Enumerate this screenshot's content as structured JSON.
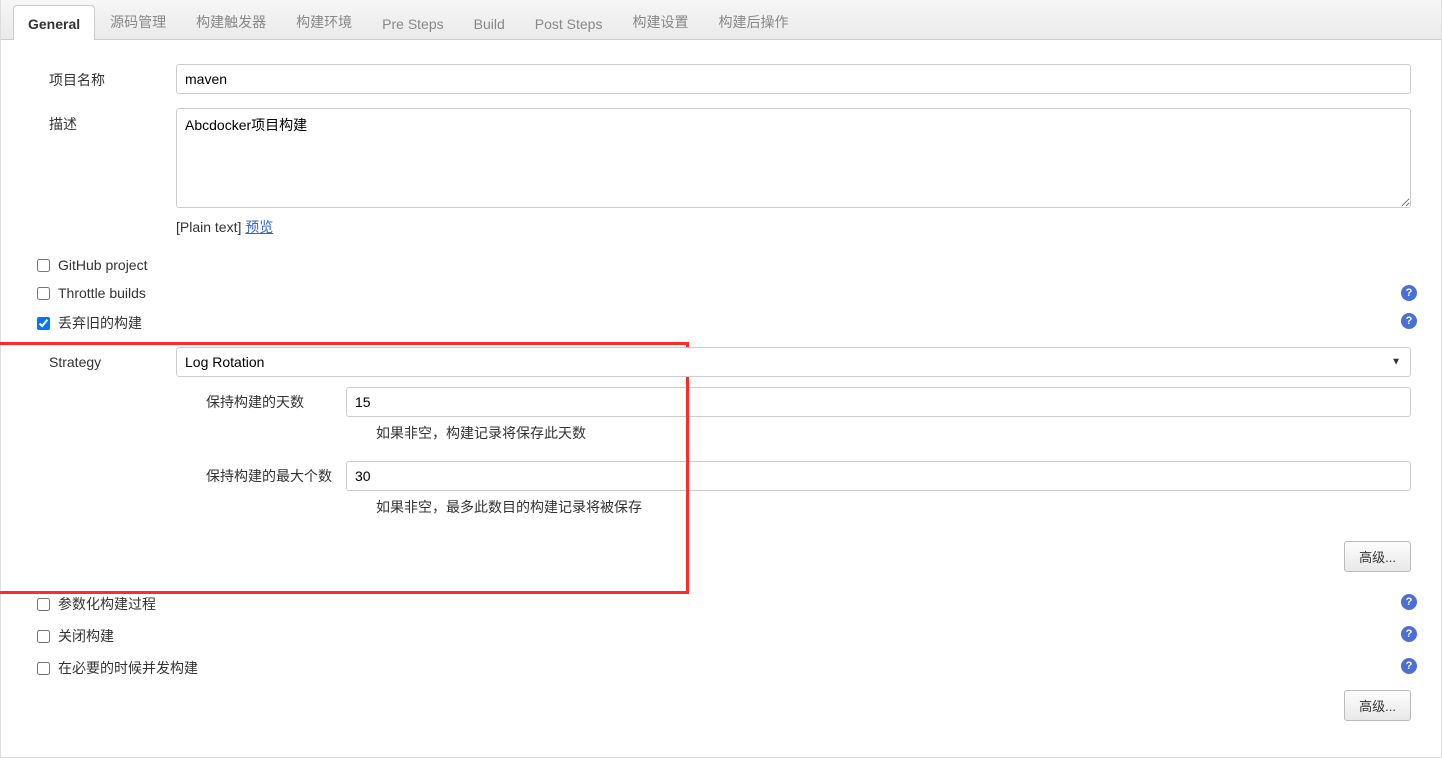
{
  "tabs": [
    {
      "label": "General"
    },
    {
      "label": "源码管理"
    },
    {
      "label": "构建触发器"
    },
    {
      "label": "构建环境"
    },
    {
      "label": "Pre Steps"
    },
    {
      "label": "Build"
    },
    {
      "label": "Post Steps"
    },
    {
      "label": "构建设置"
    },
    {
      "label": "构建后操作"
    }
  ],
  "form": {
    "project_name_label": "项目名称",
    "project_name_value": "maven",
    "description_label": "描述",
    "description_value": "Abcdocker项目构建",
    "plaintext_label": "[Plain text]",
    "preview_label": "预览"
  },
  "checkboxes": {
    "github_project": "GitHub project",
    "throttle_builds": "Throttle builds",
    "discard_old_builds": "丢弃旧的构建",
    "parameterized": "参数化构建过程",
    "disable_build": "关闭构建",
    "concurrent": "在必要的时候并发构建"
  },
  "strategy": {
    "label": "Strategy",
    "value": "Log Rotation",
    "keep_days_label": "保持构建的天数",
    "keep_days_value": "15",
    "keep_days_hint": "如果非空，构建记录将保存此天数",
    "keep_max_label": "保持构建的最大个数",
    "keep_max_value": "30",
    "keep_max_hint": "如果非空，最多此数目的构建记录将被保存"
  },
  "advanced_label": "高级..."
}
